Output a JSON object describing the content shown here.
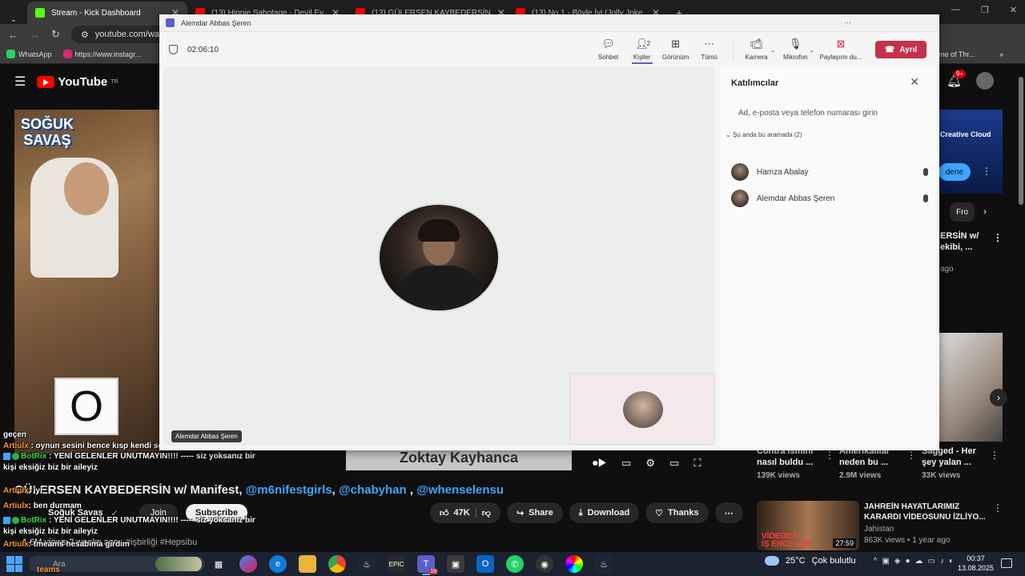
{
  "browser": {
    "tabs": [
      {
        "title": "Stream - Kick Dashboard",
        "color": "#53fc18",
        "active": true
      },
      {
        "title": "(13) Hippie Sabotage - Devil Ey",
        "color": "#ff0000",
        "active": false
      },
      {
        "title": "(13) GÜLERSEN KAYBEDERSİN",
        "color": "#ff0000",
        "active": false
      },
      {
        "title": "(13) No.1 - Böyle İyi (Jolly Joke",
        "color": "#ff0000",
        "active": false
      }
    ],
    "address": "youtube.com/wa",
    "bookmarks": [
      {
        "label": "WhatsApp",
        "color": "#25d366"
      },
      {
        "label": "https://www.instagr...",
        "color": "#d62976"
      }
    ],
    "bookmark_right": "me of Thr..."
  },
  "youtube": {
    "logo": "YouTube",
    "region": "TR",
    "show_logo_line1": "SOĞUK",
    "show_logo_line2": "SAVAŞ",
    "overlay_letter": "O",
    "caption": "Zoktay Kayhanca",
    "title_prefix": "GÜLERSEN KAYBEDERSİN w/ Manifest,",
    "title_tags": [
      "@m6nifestgirls",
      "@chabyhan",
      "@whenselensu"
    ],
    "channel": "Soğuk Savaş",
    "join": "Join",
    "subscribe": "Subscribe",
    "like_count": "47K",
    "share": "Share",
    "download": "Download",
    "thanks": "Thanks",
    "views": "1.6M views",
    "posted": "3 weeks ago",
    "hashtag": "#işbirliği #Hepsibu",
    "notif_count": "9+",
    "ad_text": "Creative Cloud",
    "ad_button": "dene",
    "chip": "Fro",
    "side_1_title": "ERSİN w/",
    "side_1_title2": "ekibi, ...",
    "side_1_meta": "ago",
    "bottom": [
      {
        "title": "Contra ismini",
        "title2": "nasıl buldu ...",
        "views": "139K views"
      },
      {
        "title": "Amerikalılar",
        "title2": "neden bu ...",
        "views": "2.9M views"
      },
      {
        "title": "Sagged - Her",
        "title2": "şey yalan ...",
        "views": "33K views"
      }
    ],
    "rec_title": "JAHREİN HAYATLARIMIZ",
    "rec_title2": "KARARDI VİDEOSUNU İZLİYO...",
    "rec_channel": "Jahistan",
    "rec_meta": "863K views • 1 year ago",
    "rec_duration": "27:59",
    "rec_overlay_1": "VİDEODA",
    "rec_overlay_2": "İŞ ENCE VAR"
  },
  "chat": [
    {
      "user": "",
      "text": "geçen",
      "badge": ""
    },
    {
      "user": "Artiulx",
      "text": ": oynun sesini bence kısp kendi sesini arttır",
      "badge": ""
    },
    {
      "user": "BotRix",
      "text": ": YENİ GELENLER UNUTMAYIN!!!! ----- siz yoksanız bir",
      "badge": "bot"
    },
    {
      "user": "",
      "text": "kişi eksiğiz biz bir aileyiz",
      "badge": ""
    },
    {
      "user": "Artiulx",
      "text": ": iyi",
      "badge": ""
    },
    {
      "user": "Artiulx",
      "text": ": ben durmam",
      "badge": ""
    },
    {
      "user": "BotRix",
      "text": ": YENİ GELENLER UNUTMAYIN!!!! ----- siz yoksanız bir",
      "badge": "bot"
    },
    {
      "user": "",
      "text": "kişi eksiğiz biz bir aileyiz",
      "badge": ""
    },
    {
      "user": "Artiulx",
      "text": ": tmeams hesabıma girdim",
      "badge": ""
    }
  ],
  "chat_last": "teams",
  "teams": {
    "window_title": "Alemdar Abbas Şeren",
    "timer": "02:06:10",
    "tools": {
      "chat": "Sohbet",
      "people": "Kişiler",
      "people_count": "2",
      "view": "Görünüm",
      "more": "Tümü",
      "camera": "Kamera",
      "mic": "Mikrofon",
      "share": "Paylaşımı du...",
      "leave": "Ayrıl"
    },
    "self_name": "Alemdar Abbas Şeren",
    "panel": {
      "title": "Katılımcılar",
      "invite_placeholder": "Ad, e-posta veya telefon numarası girin",
      "section": "Şu anda bu aramada (2)",
      "participants": [
        {
          "name": "Hamza Abalay"
        },
        {
          "name": "Alemdar Abbas Şeren"
        }
      ]
    }
  },
  "taskbar": {
    "search": "Ara",
    "teams_badge": "18",
    "temperature": "25°C",
    "weather": "Çok bulutlu",
    "time": "00:37",
    "date": "13.08.2025"
  }
}
